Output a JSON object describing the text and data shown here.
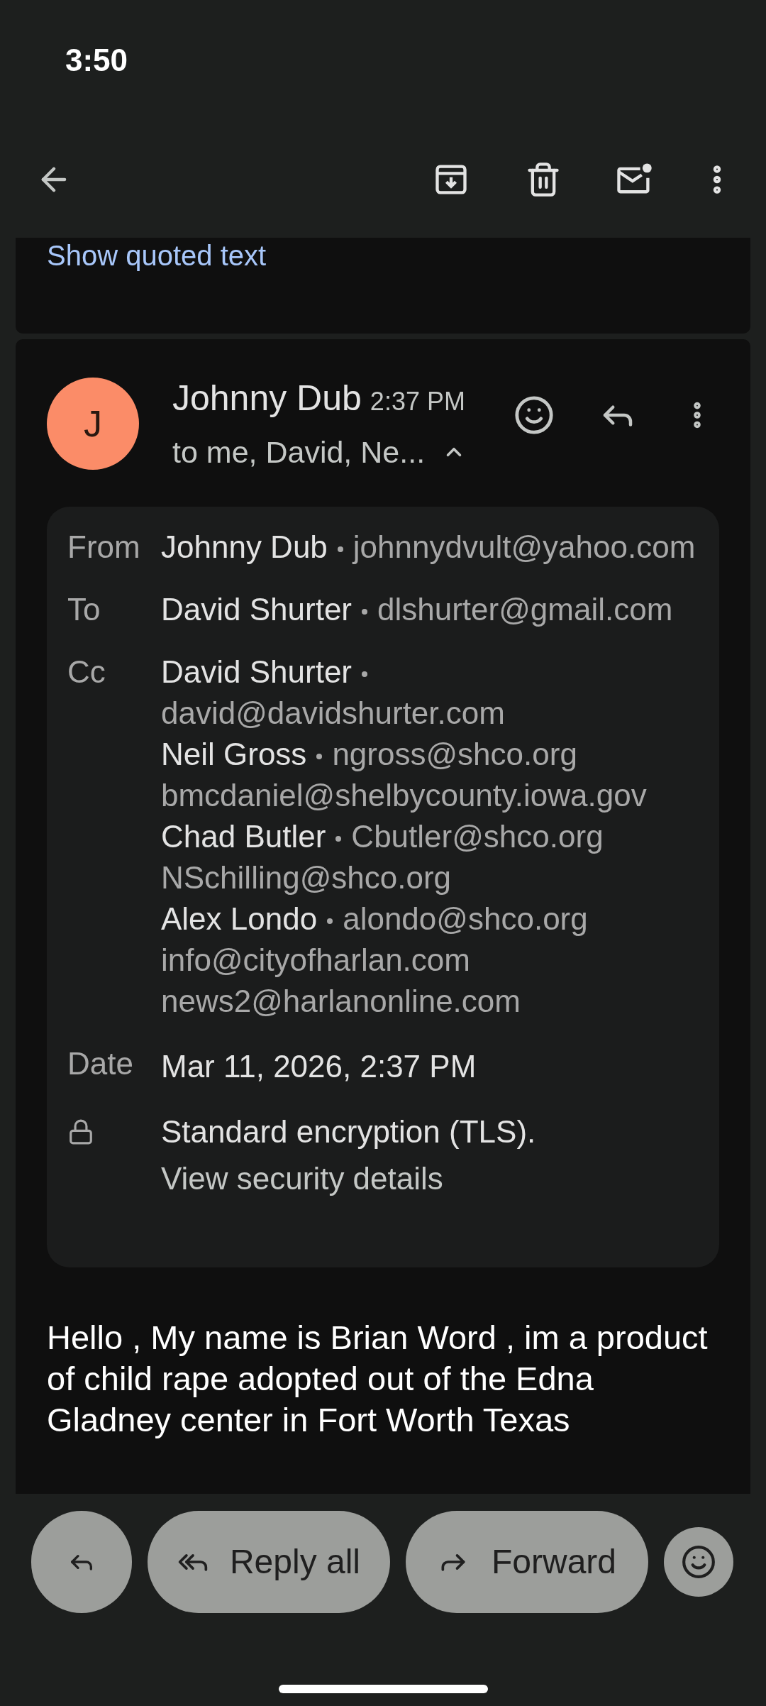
{
  "status_bar": {
    "time": "3:50"
  },
  "quoted_card": {
    "link": "Show quoted text"
  },
  "message": {
    "avatar_initial": "J",
    "sender": "Johnny Dub",
    "time": "2:37 PM",
    "recipients_summary": "to me, David, Ne...",
    "expanded": true,
    "details": [
      {
        "label": "From",
        "entries": [
          {
            "name": "Johnny Dub",
            "email": "johnnydvult@yahoo.com"
          }
        ]
      },
      {
        "label": "To",
        "entries": [
          {
            "name": "David Shurter",
            "email": "dlshurter@gmail.com"
          }
        ]
      },
      {
        "label": "Cc",
        "entries": [
          {
            "name": "David Shurter",
            "email": "david@davidshurter.com"
          },
          {
            "name": "Neil Gross",
            "email": "ngross@shco.org"
          },
          {
            "email": "bmcdaniel@shelbycounty.iowa.gov"
          },
          {
            "name": "Chad Butler",
            "email": "Cbutler@shco.org"
          },
          {
            "email": "NSchilling@shco.org"
          },
          {
            "name": "Alex Londo",
            "email": "alondo@shco.org"
          },
          {
            "email": "info@cityofharlan.com"
          },
          {
            "email": "news2@harlanonline.com"
          }
        ]
      },
      {
        "label": "Date",
        "value": "Mar 11, 2026, 2:37 PM"
      }
    ],
    "security": {
      "text": "Standard encryption (TLS).",
      "link": "View security details"
    },
    "body": "Hello , My name is Brian Word , im a product of child rape adopted out of the Edna Gladney center in Fort Worth Texas"
  },
  "actions": [
    {
      "kind": "reply"
    },
    {
      "kind": "reply_all",
      "label": "Reply all"
    },
    {
      "kind": "forward",
      "label": "Forward"
    },
    {
      "kind": "react"
    }
  ]
}
